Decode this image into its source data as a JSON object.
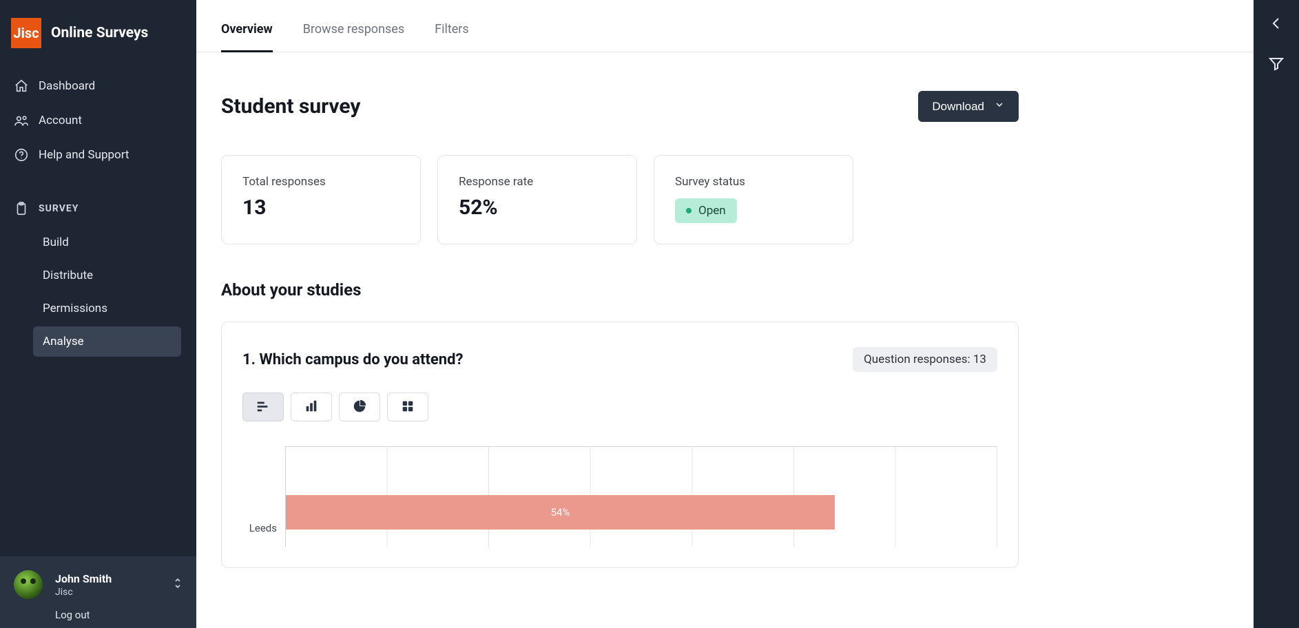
{
  "brand": {
    "logo_text": "Jisc",
    "title": "Online Surveys"
  },
  "nav": {
    "items": [
      {
        "label": "Dashboard"
      },
      {
        "label": "Account"
      },
      {
        "label": "Help and Support"
      }
    ],
    "section_label": "SURVEY",
    "subitems": [
      {
        "label": "Build"
      },
      {
        "label": "Distribute"
      },
      {
        "label": "Permissions"
      },
      {
        "label": "Analyse",
        "active": true
      }
    ]
  },
  "user": {
    "name": "John Smith",
    "org": "Jisc",
    "logout_label": "Log out"
  },
  "tabs": [
    {
      "label": "Overview",
      "active": true
    },
    {
      "label": "Browse responses"
    },
    {
      "label": "Filters"
    }
  ],
  "page": {
    "title": "Student survey",
    "download_label": "Download"
  },
  "stats": {
    "total_responses": {
      "label": "Total responses",
      "value": "13"
    },
    "response_rate": {
      "label": "Response rate",
      "value": "52%"
    },
    "survey_status": {
      "label": "Survey status",
      "value": "Open"
    }
  },
  "section": {
    "title": "About your studies"
  },
  "question": {
    "title": "1. Which campus do you attend?",
    "responses_pill": "Question responses: 13"
  },
  "chart_data": {
    "type": "bar",
    "orientation": "horizontal",
    "categories": [
      "Leeds"
    ],
    "values": [
      54
    ],
    "value_labels": [
      "54%"
    ],
    "xlabel": "",
    "ylabel": "",
    "xlim": [
      0,
      70
    ],
    "title": ""
  }
}
